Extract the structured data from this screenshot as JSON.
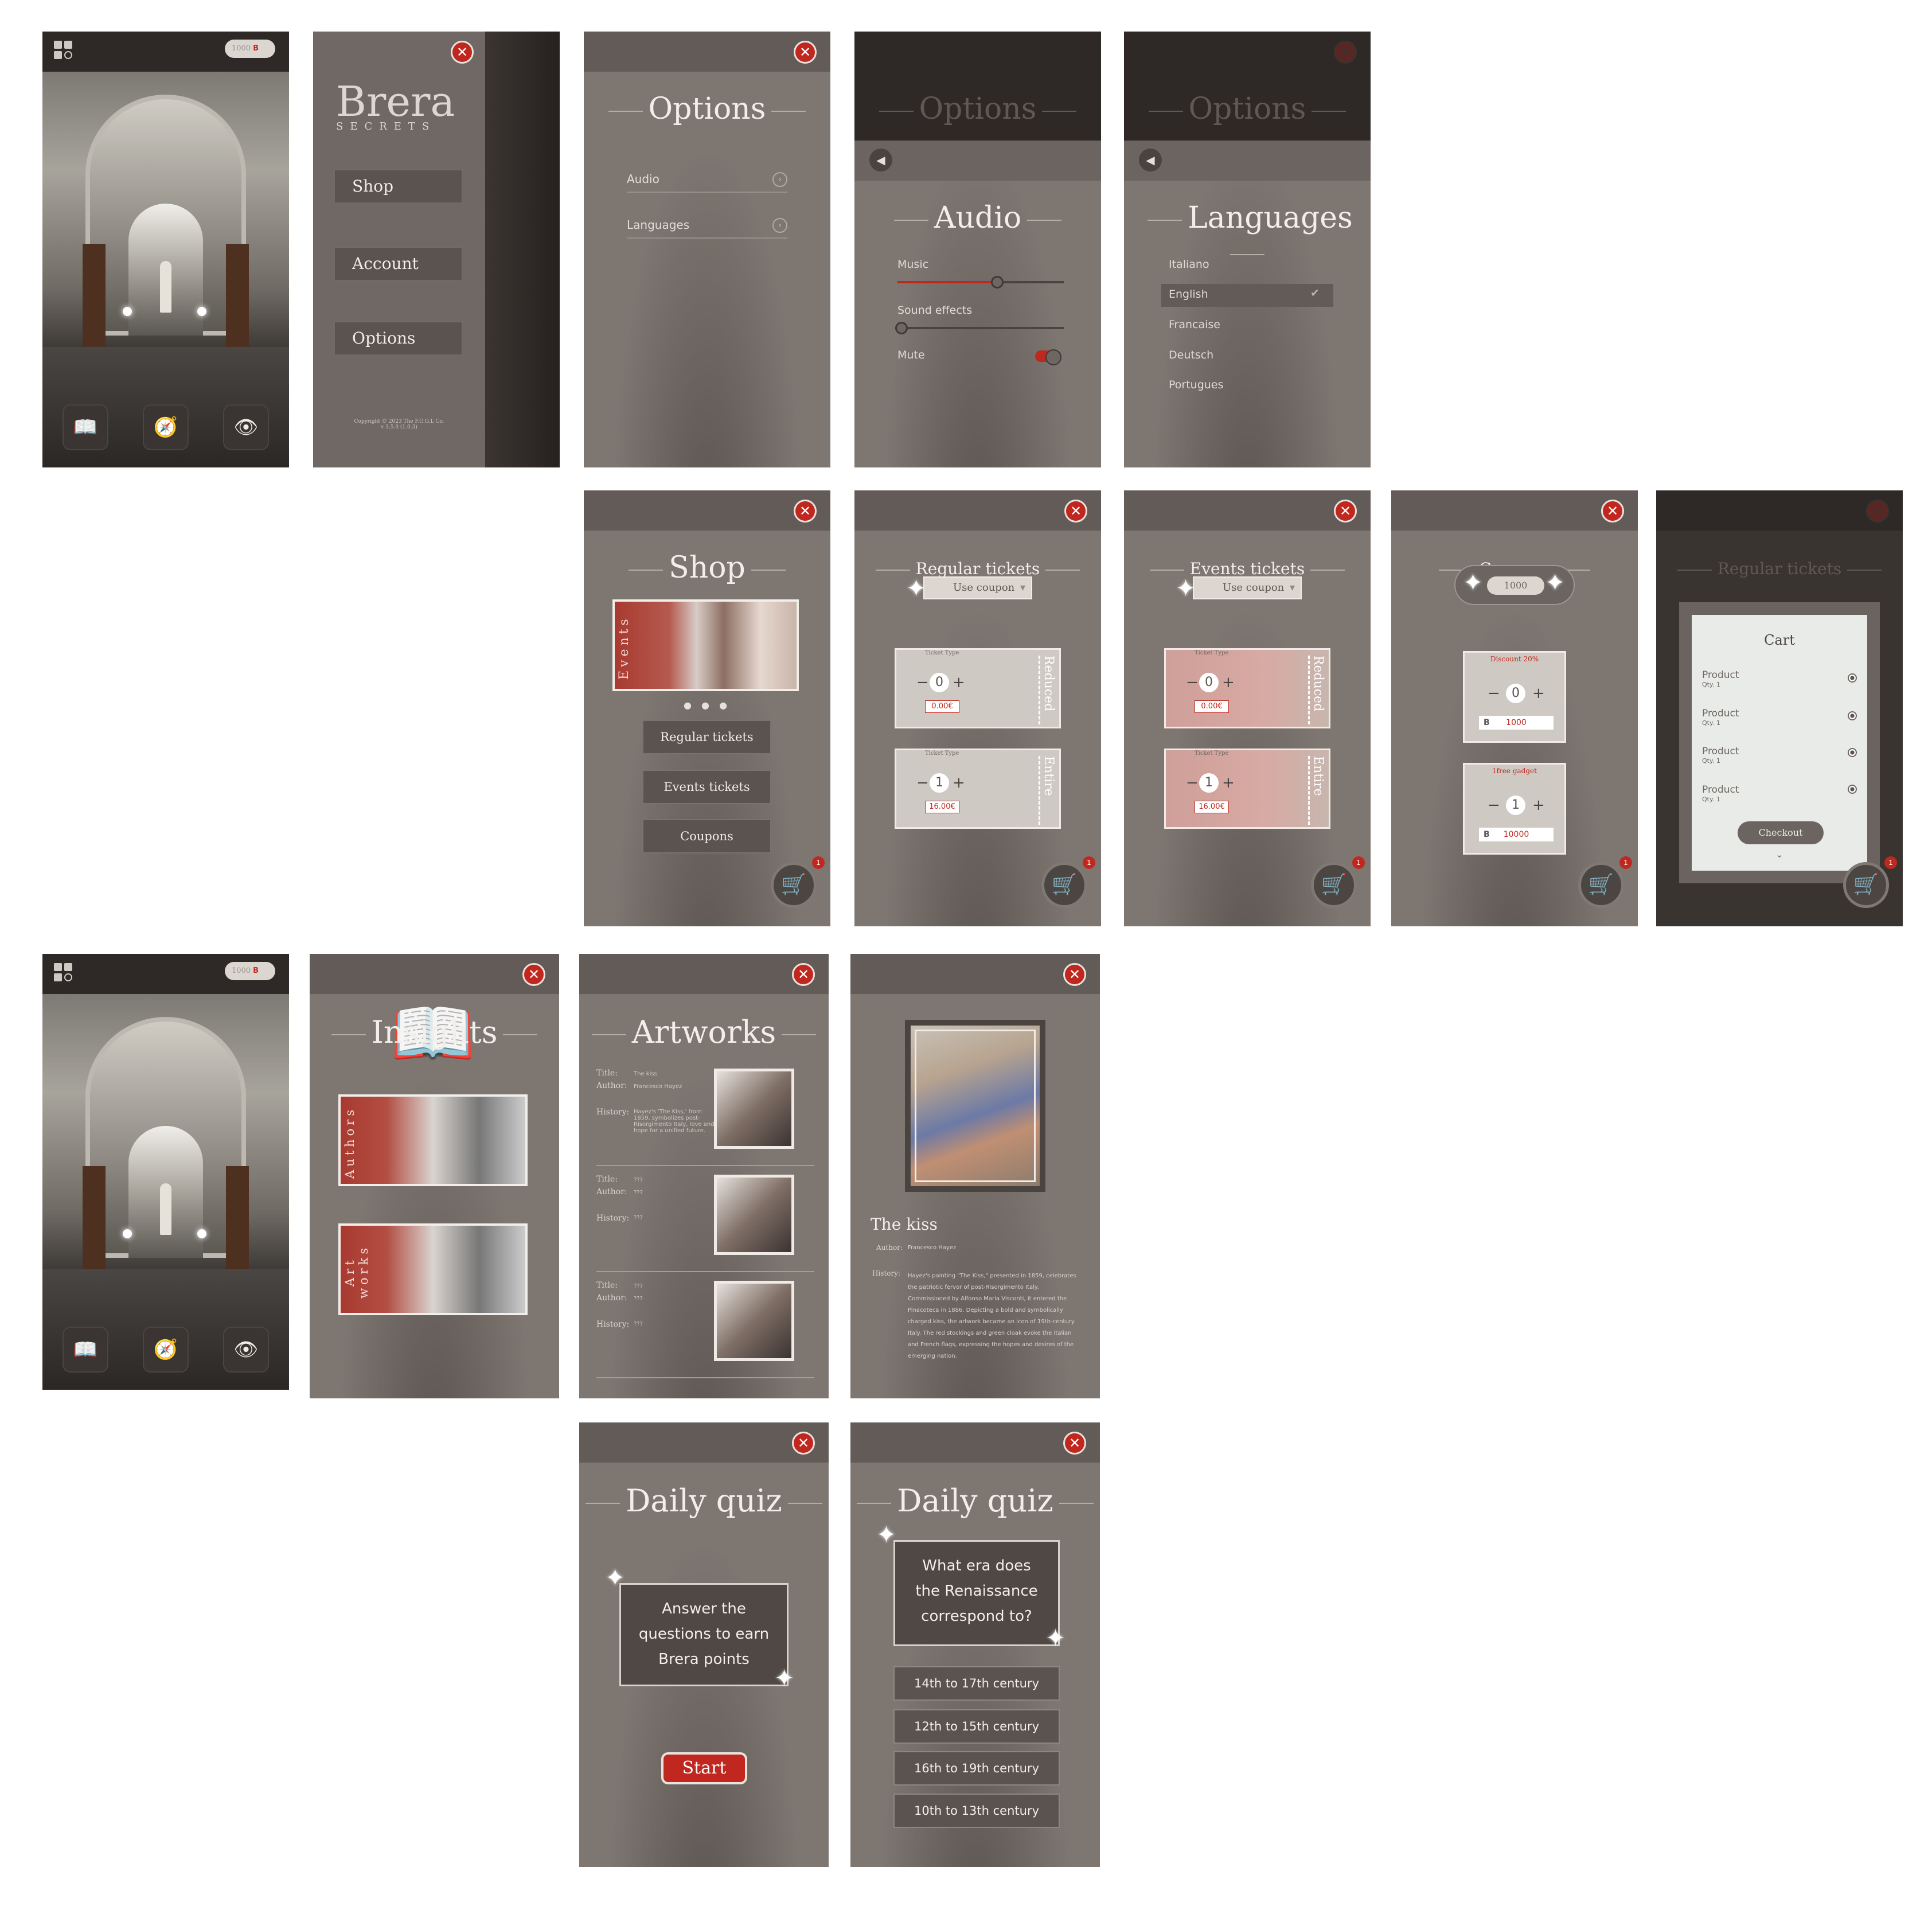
{
  "home": {
    "coins": "1000",
    "currency": "B"
  },
  "menu": {
    "brand": "Brera",
    "brand_sub": "SECRETS",
    "items": [
      "Shop",
      "Account",
      "Options"
    ],
    "copyright": "Copyright © 2023 The F.O.G.L Co.",
    "version": "v 3.5.0 (1.0.3)"
  },
  "options": {
    "title": "Options",
    "items": [
      "Audio",
      "Languages"
    ]
  },
  "audio": {
    "title": "Audio",
    "music": "Music",
    "music_level": 0.6,
    "sfx": "Sound effects",
    "sfx_level": 0.0,
    "mute": "Mute",
    "mute_on": true
  },
  "languages": {
    "title": "Languages",
    "items": [
      "Italiano",
      "English",
      "Francaise",
      "Deutsch",
      "Portugues"
    ],
    "selected": "English"
  },
  "shop": {
    "title": "Shop",
    "banner": "Events",
    "buttons": [
      "Regular tickets",
      "Events tickets",
      "Coupons"
    ],
    "cart_count": "1"
  },
  "regular": {
    "title": "Regular tickets",
    "use_coupon": "Use coupon",
    "ticket_type": "Ticket Type",
    "tickets": [
      {
        "qty": "0",
        "price": "0.00€",
        "kind": "Reduced"
      },
      {
        "qty": "1",
        "price": "16.00€",
        "kind": "Entire"
      }
    ]
  },
  "events": {
    "title": "Events tickets",
    "use_coupon": "Use coupon",
    "ticket_type": "Ticket Type",
    "tickets": [
      {
        "qty": "0",
        "price": "0.00€",
        "kind": "Reduced"
      },
      {
        "qty": "1",
        "price": "16.00€",
        "kind": "Entire"
      }
    ]
  },
  "coupons": {
    "title": "Coupons",
    "balance": "1000",
    "items": [
      {
        "name": "Discount 20%",
        "qty": "0",
        "cost": "1000"
      },
      {
        "name": "1free gadget",
        "qty": "1",
        "cost": "10000"
      }
    ]
  },
  "cart": {
    "bg_title": "Regular tickets",
    "title": "Cart",
    "items": [
      {
        "name": "Product",
        "qty": "Qty. 1"
      },
      {
        "name": "Product",
        "qty": "Qty. 1"
      },
      {
        "name": "Product",
        "qty": "Qty. 1"
      },
      {
        "name": "Product",
        "qty": "Qty. 1"
      }
    ],
    "checkout": "Checkout"
  },
  "insights": {
    "title": "Insights",
    "cards": [
      "Authors",
      "Art works"
    ]
  },
  "artworks": {
    "title": "Artworks",
    "labels": {
      "title": "Title:",
      "author": "Author:",
      "history": "History:"
    },
    "items": [
      {
        "title": "The kiss",
        "author": "Francesco Hayez",
        "history": "Hayez's 'The Kiss,' from 1859, symbolizes post-Risorgimento Italy, love and hope for a unified future."
      },
      {
        "title": "???",
        "author": "???",
        "history": "???"
      },
      {
        "title": "???",
        "author": "???",
        "history": "???"
      }
    ]
  },
  "detail": {
    "title": "The kiss",
    "author_label": "Author:",
    "author": "Francesco Hayez",
    "history_label": "History:",
    "history": "Hayez's painting \"The Kiss,\" presented in 1859, celebrates the patriotic fervor of post-Risorgimento Italy. Commissioned by Alfonso Maria Visconti, it entered the Pinacoteca in 1886. Depicting a bold and symbolically charged kiss, the artwork became an icon of 19th-century Italy. The red stockings and green cloak evoke the Italian and French flags, expressing the hopes and desires of the emerging nation."
  },
  "quiz1": {
    "title": "Daily quiz",
    "prompt": "Answer the questions to earn Brera points",
    "start": "Start"
  },
  "quiz2": {
    "title": "Daily quiz",
    "question": "What era does the Renaissance correspond to?",
    "options": [
      "14th to 17th century",
      "12th to 15th century",
      "16th to 19th century",
      "10th to 13th century"
    ]
  },
  "colors": {
    "accent": "#c0281f",
    "panel": "#7e7671",
    "topbar": "#625b57",
    "dark": "#2e2926"
  }
}
